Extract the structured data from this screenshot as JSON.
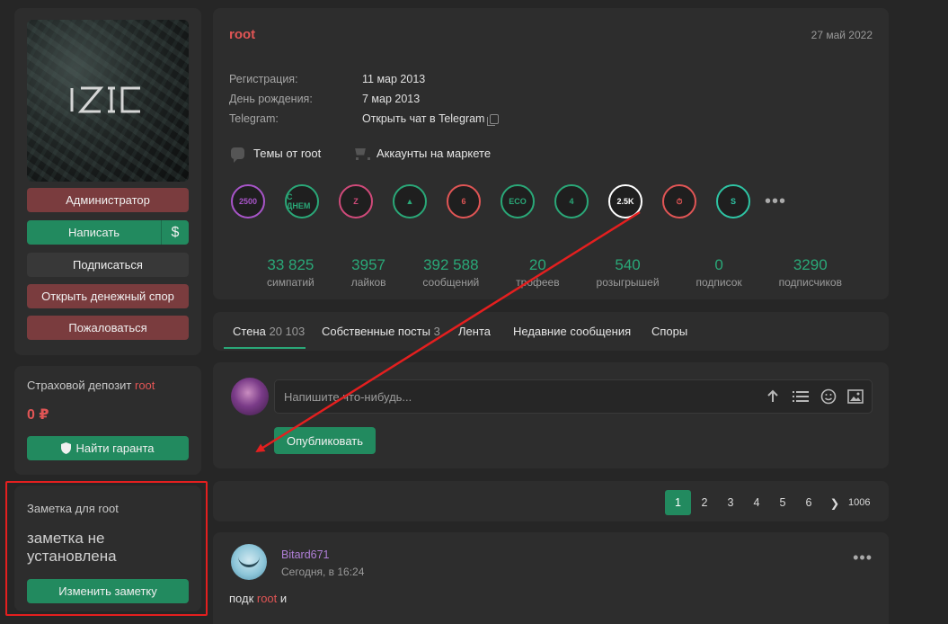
{
  "left": {
    "buttons": {
      "admin": "Администратор",
      "write": "Написать",
      "write_side": "$",
      "subscribe": "Подписаться",
      "dispute": "Открыть денежный спор",
      "report": "Пожаловаться"
    },
    "deposit": {
      "title_prefix": "Страховой депозит ",
      "title_user": "root",
      "amount": "0 ₽",
      "guarantor_button": "Найти гаранта"
    },
    "note": {
      "title": "Заметка для root",
      "text": "заметка не установлена",
      "edit_button": "Изменить заметку"
    }
  },
  "profile": {
    "username": "root",
    "date": "27 май 2022",
    "info": [
      {
        "label": "Регистрация:",
        "value": "11 мар 2013"
      },
      {
        "label": "День рождения:",
        "value": "7 мар 2013"
      },
      {
        "label": "Telegram:",
        "value": "Открыть чат в Telegram"
      }
    ],
    "links": {
      "topics": "Темы от root",
      "market": "Аккаунты на маркете"
    },
    "trophies": [
      {
        "icon": "trophy-heart-2500",
        "text": "2500",
        "color": "#a855c9"
      },
      {
        "icon": "trophy-day-z",
        "text": "С ДНЕМ",
        "color": "#2aa878"
      },
      {
        "icon": "trophy-z",
        "text": "Z",
        "color": "#d04a7a"
      },
      {
        "icon": "trophy-triangle",
        "text": "▲",
        "color": "#2aa878"
      },
      {
        "icon": "trophy-6",
        "text": "6",
        "color": "#e05555"
      },
      {
        "icon": "trophy-eco",
        "text": "ECO",
        "color": "#2aa878"
      },
      {
        "icon": "trophy-4-years",
        "text": "4",
        "color": "#2aa878"
      },
      {
        "icon": "trophy-2-5k",
        "text": "2.5K",
        "color": "#ffffff"
      },
      {
        "icon": "trophy-active",
        "text": "⏱",
        "color": "#e05555"
      },
      {
        "icon": "trophy-s",
        "text": "S",
        "color": "#2ec4a4"
      }
    ],
    "more": "•••",
    "stats": [
      {
        "value": "33 825",
        "label": "симпатий"
      },
      {
        "value": "3957",
        "label": "лайков"
      },
      {
        "value": "392 588",
        "label": "сообщений"
      },
      {
        "value": "20",
        "label": "трофеев"
      },
      {
        "value": "540",
        "label": "розыгрышей"
      },
      {
        "value": "0",
        "label": "подписок"
      },
      {
        "value": "3290",
        "label": "подписчиков"
      }
    ]
  },
  "tabs": [
    {
      "label": "Стена",
      "count": "20 103"
    },
    {
      "label": "Собственные посты",
      "count": "3"
    },
    {
      "label": "Лента",
      "count": ""
    },
    {
      "label": "Недавние сообщения",
      "count": ""
    },
    {
      "label": "Споры",
      "count": ""
    }
  ],
  "composer": {
    "placeholder": "Напишите что-нибудь...",
    "publish": "Опубликовать"
  },
  "pagination": {
    "pages": [
      "1",
      "2",
      "3",
      "4",
      "5",
      "6"
    ],
    "next": "❯",
    "last": "1006"
  },
  "post": {
    "author": "Bitard671",
    "time": "Сегодня, в 16:24",
    "text_prefix": "подк ",
    "text_user": "root",
    "text_suffix": " и",
    "menu": "•••"
  },
  "colors": {
    "accent": "#228a5f",
    "danger": "#7a3c3e",
    "username": "#e05555",
    "annotation": "#e41f1f"
  }
}
